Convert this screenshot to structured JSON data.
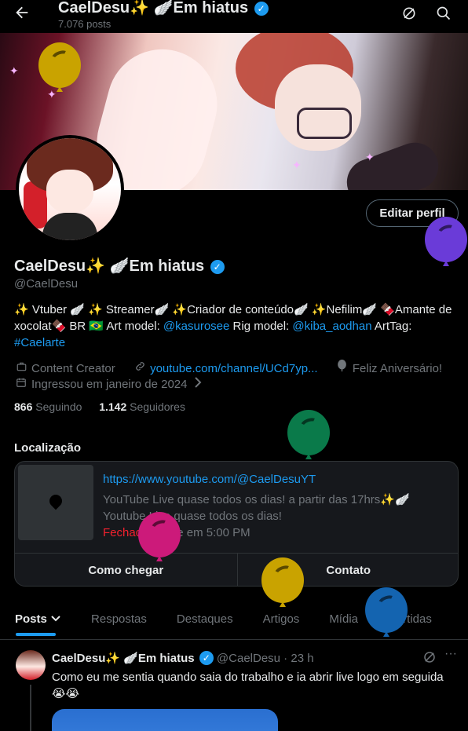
{
  "header": {
    "title": "CaelDesu✨ 🪽Em hiatus",
    "subtitle": "7.076 posts"
  },
  "profile": {
    "display_name": "CaelDesu✨ 🪽Em hiatus",
    "handle": "@CaelDesu",
    "edit_button": "Editar perfil",
    "bio_part1": "✨ Vtuber 🪽 ✨ Streamer🪽 ✨Criador de conteúdo🪽 ✨Nefilim🪽 🍫Amante de xocolat🍫 BR 🇧🇷 Art model: ",
    "bio_link1": "@kasurosee",
    "bio_part2": " Rig model: ",
    "bio_link2": "@kiba_aodhan",
    "bio_part3": " ArtTag: ",
    "bio_link3": "#Caelarte",
    "category": "Content Creator",
    "website": "youtube.com/channel/UCd7yp...",
    "birthday": "Feliz Aniversário!",
    "joined": "Ingressou em janeiro de 2024",
    "following_count": "866",
    "following_label": "Seguindo",
    "followers_count": "1.142",
    "followers_label": "Seguidores"
  },
  "location": {
    "label": "Localização",
    "url": "https://www.youtube.com/@CaelDesuYT",
    "desc": "YouTube Live quase todos os dias! a partir das 17hrs✨🪽 Youtube Live quase todos os dias!",
    "status_closed": "Fechado",
    "status_sep": " · ",
    "status_opens": "Abre em 5:00 PM",
    "btn_directions": "Como chegar",
    "btn_contact": "Contato"
  },
  "tabs": [
    {
      "label": "Posts"
    },
    {
      "label": "Respostas"
    },
    {
      "label": "Destaques"
    },
    {
      "label": "Artigos"
    },
    {
      "label": "Mídia"
    },
    {
      "label": "Curtidas"
    }
  ],
  "post": {
    "name": "CaelDesu✨ 🪽Em hiatus",
    "handle": "@CaelDesu",
    "time": "23 h",
    "text": "Como eu me sentia quando saia do trabalho e ia abrir live logo em seguida 😭😭"
  },
  "colors": {
    "accent": "#1d9bf0",
    "closed": "#f4212e",
    "balloon_yellow": "#c9a300",
    "balloon_purple": "#6a3bd8",
    "balloon_green": "#0a7a4a",
    "balloon_pink": "#cc1a7a",
    "balloon_blue": "#1464b0"
  },
  "icons": {
    "back": "arrow-left-icon",
    "grok": "grok-icon",
    "search": "search-icon",
    "category": "briefcase-icon",
    "link": "link-icon",
    "birthday": "balloon-icon",
    "calendar": "calendar-icon",
    "map_pin": "map-pin-icon"
  }
}
